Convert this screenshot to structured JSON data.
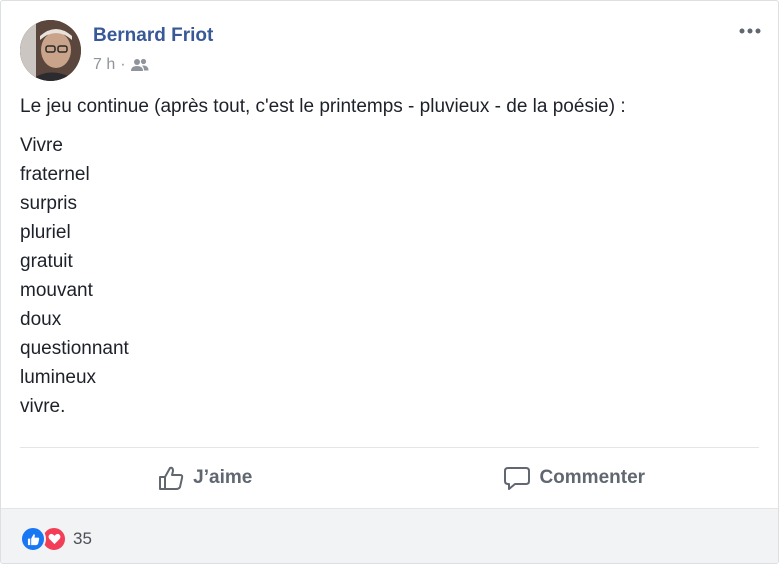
{
  "post": {
    "author": "Bernard Friot",
    "time": "7 h",
    "separator": "·",
    "audience_icon": "friends-icon",
    "more_icon": "more-dots-icon",
    "intro": "Le jeu continue (après tout, c'est le printemps - pluvieux - de la poésie) :",
    "poem": {
      "line1": "Vivre",
      "line2": "fraternel",
      "line3": "surpris",
      "line4": "pluriel",
      "line5": "gratuit",
      "line6": "mouvant",
      "line7": "doux",
      "line8": "questionnant",
      "line9": "lumineux",
      "line10": "vivre."
    }
  },
  "actions": {
    "like_label": "J’aime",
    "comment_label": "Commenter"
  },
  "reactions": {
    "count": "35",
    "types": [
      "like",
      "love"
    ]
  },
  "colors": {
    "author": "#385898",
    "meta": "#90949c",
    "text": "#1d2129",
    "action": "#606770",
    "like": "#1877f2",
    "love": "#f33e58",
    "footer_bg": "#f2f3f5"
  }
}
